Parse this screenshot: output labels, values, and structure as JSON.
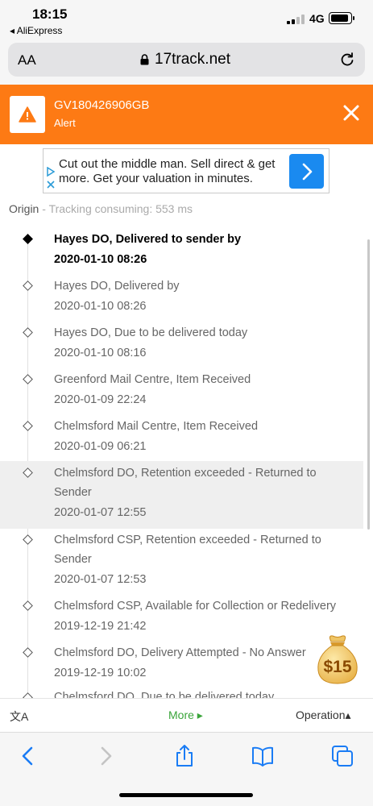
{
  "status_bar": {
    "time": "18:15",
    "back_app": "◂ AliExpress",
    "network": "4G"
  },
  "browser": {
    "text_size": "AA",
    "url": "17track.net"
  },
  "alert": {
    "tracking_number": "GV180426906GB",
    "status": "Alert"
  },
  "ad": {
    "text": "Cut out the middle man. Sell direct & get more. Get your valuation in minutes."
  },
  "origin": {
    "label": "Origin",
    "separator": " - ",
    "consuming": "Tracking consuming: 553 ms"
  },
  "events": [
    {
      "desc": "Hayes DO, Delivered to sender by",
      "time": "2020-01-10 08:26"
    },
    {
      "desc": "Hayes DO, Delivered by",
      "time": "2020-01-10 08:26"
    },
    {
      "desc": "Hayes DO, Due to be delivered today",
      "time": "2020-01-10 08:16"
    },
    {
      "desc": "Greenford Mail Centre, Item Received",
      "time": "2020-01-09 22:24"
    },
    {
      "desc": "Chelmsford Mail Centre, Item Received",
      "time": "2020-01-09 06:21"
    },
    {
      "desc": "Chelmsford DO, Retention exceeded - Returned to Sender",
      "time": "2020-01-07 12:55"
    },
    {
      "desc": "Chelmsford CSP, Retention exceeded - Returned to Sender",
      "time": "2020-01-07 12:53"
    },
    {
      "desc": "Chelmsford CSP, Available for Collection or Redelivery",
      "time": "2019-12-19 21:42"
    },
    {
      "desc": "Chelmsford DO, Delivery Attempted - No Answer",
      "time": "2019-12-19 10:02"
    },
    {
      "desc": "Chelmsford DO, Due to be delivered today",
      "time": ""
    }
  ],
  "coin": {
    "amount": "$15"
  },
  "page_toolbar": {
    "translate": "文A",
    "more": "More ▸",
    "operation": "Operation▴"
  }
}
